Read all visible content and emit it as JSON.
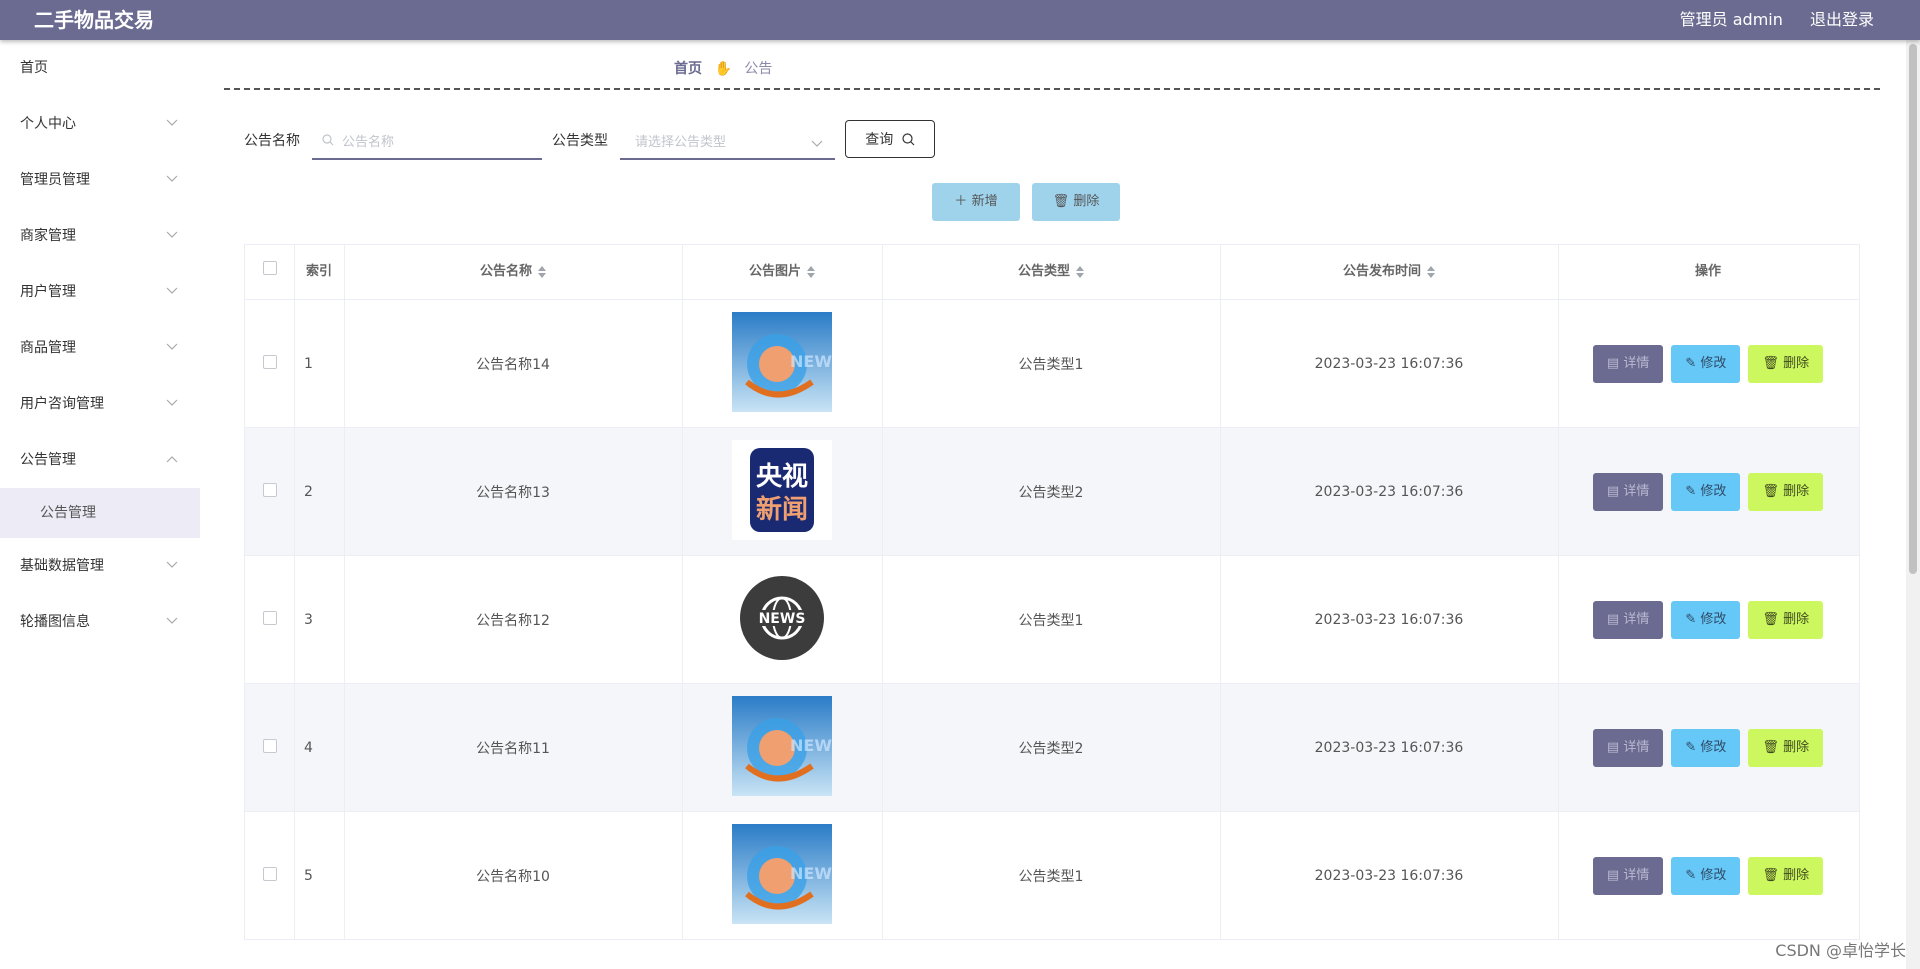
{
  "app": {
    "title": "二手物品交易"
  },
  "header": {
    "user_label": "管理员 admin",
    "logout_label": "退出登录"
  },
  "sidebar": {
    "items": [
      {
        "label": "首页"
      },
      {
        "label": "个人中心"
      },
      {
        "label": "管理员管理"
      },
      {
        "label": "商家管理"
      },
      {
        "label": "用户管理"
      },
      {
        "label": "商品管理"
      },
      {
        "label": "用户咨询管理"
      },
      {
        "label": "公告管理"
      },
      {
        "label": "基础数据管理"
      },
      {
        "label": "轮播图信息"
      }
    ],
    "submenu": {
      "label": "公告管理"
    }
  },
  "breadcrumb": {
    "home": "首页",
    "current": "公告"
  },
  "search": {
    "name_label": "公告名称",
    "name_placeholder": "公告名称",
    "type_label": "公告类型",
    "type_placeholder": "请选择公告类型",
    "query_label": "查询"
  },
  "actions": {
    "add_label": "新增",
    "delete_label": "删除"
  },
  "table": {
    "headers": {
      "index": "索引",
      "name": "公告名称",
      "image": "公告图片",
      "type": "公告类型",
      "time": "公告发布时间",
      "ops": "操作"
    },
    "op_labels": {
      "detail": "详情",
      "edit": "修改",
      "delete": "删除"
    },
    "rows": [
      {
        "index": "1",
        "name": "公告名称14",
        "image": "news-globe-image",
        "type": "公告类型1",
        "time": "2023-03-23 16:07:36"
      },
      {
        "index": "2",
        "name": "公告名称13",
        "image": "cctv-news-logo",
        "type": "公告类型2",
        "time": "2023-03-23 16:07:36"
      },
      {
        "index": "3",
        "name": "公告名称12",
        "image": "news-circle-icon",
        "type": "公告类型1",
        "time": "2023-03-23 16:07:36"
      },
      {
        "index": "4",
        "name": "公告名称11",
        "image": "news-globe-image",
        "type": "公告类型2",
        "time": "2023-03-23 16:07:36"
      },
      {
        "index": "5",
        "name": "公告名称10",
        "image": "news-globe-image",
        "type": "公告类型1",
        "time": "2023-03-23 16:07:36"
      }
    ]
  },
  "image_text": {
    "cctv": [
      "央视",
      "新闻"
    ],
    "news": "NEWS"
  },
  "watermark": "CSDN @卓怡学长",
  "colors": {
    "header": "#6b6b91",
    "detail": "#6b6b91",
    "edit": "#66c8f7",
    "delete": "#cdf75f",
    "light_button": "#9fd3ec"
  }
}
